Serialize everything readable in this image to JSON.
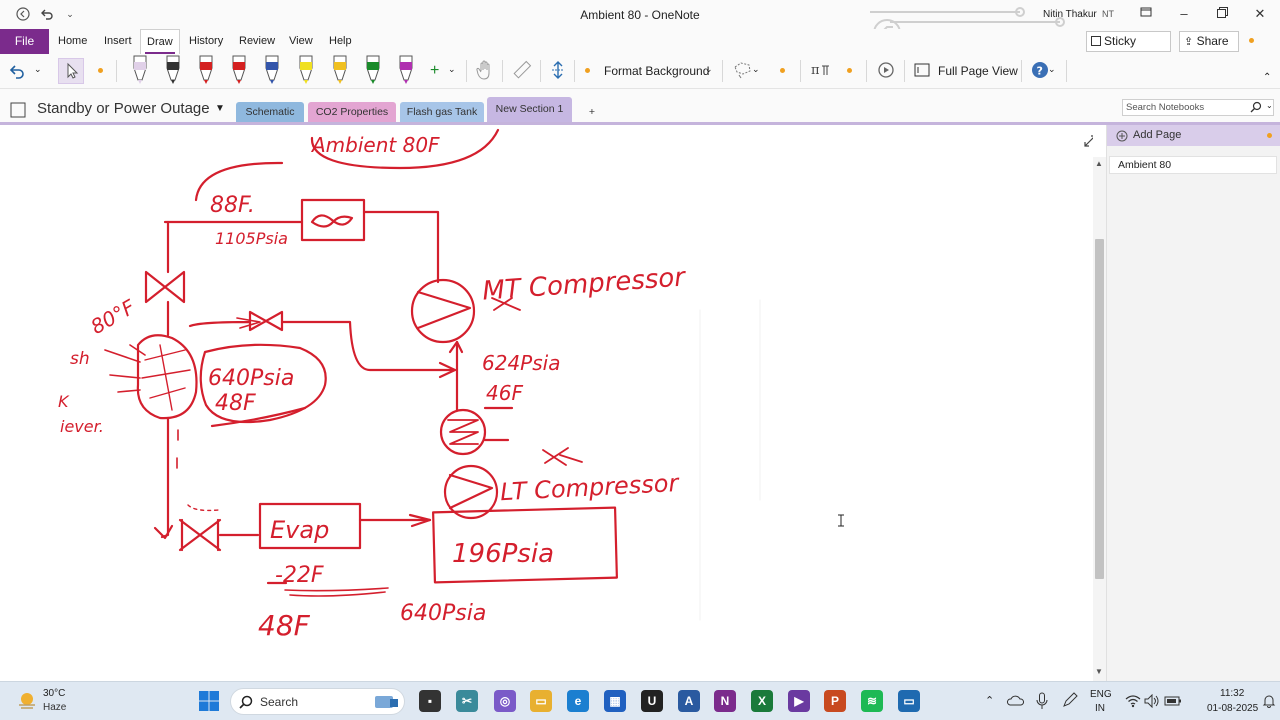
{
  "window": {
    "title": "Ambient 80  -  OneNote",
    "user_name": "Nitin Thakur",
    "user_initials": "NT"
  },
  "ribbon": {
    "tabs": [
      "File",
      "Home",
      "Insert",
      "Draw",
      "History",
      "Review",
      "View",
      "Help"
    ],
    "active_tab": "Draw",
    "sticky_notes": "Sticky Notes",
    "share": "Share"
  },
  "toolbar": {
    "format_background": "Format Background",
    "full_page_view": "Full Page View",
    "pen_colors": [
      "#e0d0e8",
      "#333333",
      "#d42020",
      "#d42020",
      "#3355aa",
      "#f0e020",
      "#f0c020",
      "#1a8a2a",
      "#b030b0"
    ]
  },
  "notebook": {
    "name": "Standby or Power Outage",
    "sections": [
      {
        "label": "Schematic",
        "color": "#8fb8de"
      },
      {
        "label": "CO2 Properties",
        "color": "#e3a5d2"
      },
      {
        "label": "Flash gas Tank",
        "color": "#a7c5e8"
      },
      {
        "label": "New Section 1",
        "color": "#c6b7e2"
      }
    ],
    "active_section": "New Section 1",
    "add_section": "+"
  },
  "search": {
    "placeholder": "Search Notebooks"
  },
  "pages": {
    "add_page": "Add Page",
    "items": [
      "Ambient 80"
    ]
  },
  "ink": {
    "ambient": "Ambient 80F",
    "temp_88": "88F.",
    "psia_1105": "1105Psia",
    "temp_80": "80°F",
    "sh": "sh",
    "k": "K",
    "receiver": "iever.",
    "flash_psia": "640Psia",
    "flash_temp": "48F",
    "mt_compressor": "MT Compressor",
    "mt_psia": "624Psia",
    "mt_temp": "46F",
    "lt_compressor": "LT Compressor",
    "evap": "Evap",
    "lt_psia": "196Psia",
    "evap_temp1": "-22F",
    "evap_temp2": "48F",
    "evap_psia": "640Psia"
  },
  "taskbar": {
    "weather_temp": "30°C",
    "weather_desc": "Haze",
    "search_label": "Search",
    "lang1": "ENG",
    "lang2": "IN",
    "time": "11:32",
    "date": "01-08-2025"
  }
}
